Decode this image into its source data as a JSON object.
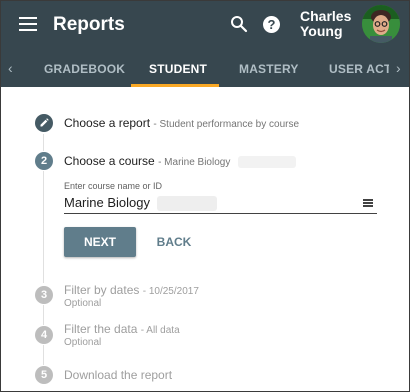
{
  "header": {
    "title": "Reports",
    "user_name": "Charles Young",
    "icons": [
      "menu-icon",
      "search-icon",
      "help-icon"
    ]
  },
  "tabs": {
    "items": [
      {
        "label": "GRADEBOOK",
        "active": false
      },
      {
        "label": "STUDENT",
        "active": true
      },
      {
        "label": "MASTERY",
        "active": false
      },
      {
        "label": "USER ACTI",
        "active": false
      }
    ],
    "left_arrow": "‹",
    "right_arrow": "›"
  },
  "steps": [
    {
      "number": "",
      "title": "Choose a report",
      "subtitle": "- Student performance by course",
      "state": "done",
      "icon": "pencil-icon"
    },
    {
      "number": "2",
      "title": "Choose a course",
      "subtitle": "- Marine Biology",
      "state": "active"
    },
    {
      "number": "3",
      "title": "Filter by dates",
      "subtitle": "- 10/25/2017",
      "optional": "Optional",
      "state": "inactive"
    },
    {
      "number": "4",
      "title": "Filter the data",
      "subtitle": "- All data",
      "optional": "Optional",
      "state": "inactive"
    },
    {
      "number": "5",
      "title": "Download the report",
      "subtitle": "",
      "state": "inactive"
    }
  ],
  "course_field": {
    "label": "Enter course name or ID",
    "value": "Marine Biology"
  },
  "buttons": {
    "next": "NEXT",
    "back": "BACK"
  },
  "colors": {
    "header_bg": "#37474f",
    "accent": "#f9a825",
    "primary_button": "#607d8b"
  }
}
